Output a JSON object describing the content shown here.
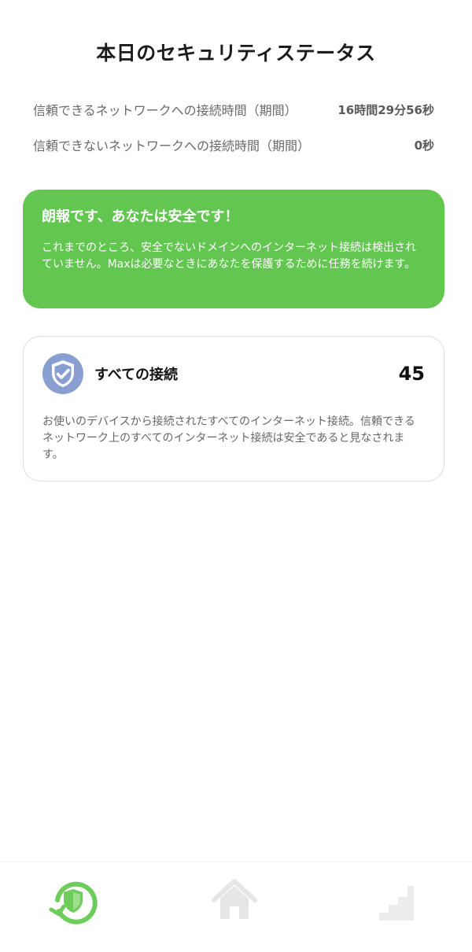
{
  "title": "本日のセキュリティステータス",
  "stats": [
    {
      "label": "信頼できるネットワークへの接続時間（期間）",
      "value": "16時間29分56秒"
    },
    {
      "label": "信頼できないネットワークへの接続時間（期間）",
      "value": "0秒"
    }
  ],
  "safe_card": {
    "headline": "朗報です、あなたは安全です！",
    "body": "これまでのところ、安全でないドメインへのインターネット接続は検出されていません。Maxは必要なときにあなたを保護するために任務を続けます。",
    "color": "#63c651"
  },
  "connections_card": {
    "title": "すべての接続",
    "count": "45",
    "description": "お使いのデバイスから接続されたすべてのインターネット接続。信頼できるネットワーク上のすべてのインターネット接続は安全であると見なされます。",
    "icon": "shield-check-icon",
    "icon_color": "#8a9fd1"
  },
  "nav": [
    {
      "name": "security-status",
      "icon": "shield-refresh-icon",
      "active": true,
      "color": "#63c651"
    },
    {
      "name": "home",
      "icon": "home-icon",
      "active": false
    },
    {
      "name": "stairs",
      "icon": "stairs-icon",
      "active": false
    }
  ]
}
